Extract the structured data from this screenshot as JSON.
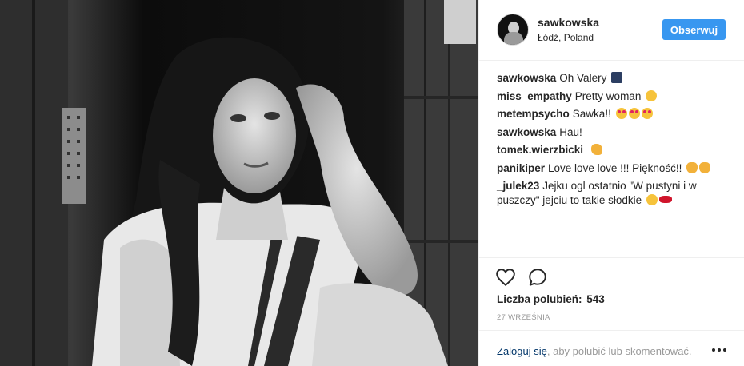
{
  "header": {
    "username": "sawkowska",
    "location": "Łódź, Poland",
    "follow_label": "Obserwuj"
  },
  "comments": [
    {
      "user": "sawkowska",
      "text": "Oh Valery",
      "emoji": [
        "camera-emoji"
      ]
    },
    {
      "user": "miss_empathy",
      "text": "Pretty woman",
      "emoji": [
        "smile-emoji"
      ]
    },
    {
      "user": "metempsycho",
      "text": "Sawka!!",
      "emoji": [
        "heart-eyes-emoji",
        "heart-eyes-emoji",
        "heart-eyes-emoji"
      ]
    },
    {
      "user": "sawkowska",
      "text": "Hau!",
      "emoji": []
    },
    {
      "user": "tomek.wierzbicki",
      "text": "",
      "emoji": [
        "muscle-emoji"
      ]
    },
    {
      "user": "panikiper",
      "text": "Love love love !!! Piękność!!",
      "emoji": [
        "ok-hand-emoji",
        "ok-hand-emoji"
      ]
    },
    {
      "user": "_julek23",
      "text": "Jejku ogl ostatnio \"W pustyni i w puszczy\" jejciu to takie słodkie",
      "emoji": [
        "crying-emoji",
        "lips-emoji"
      ]
    }
  ],
  "likes": {
    "label": "Liczba polubień:",
    "count": "543"
  },
  "date": "27 września",
  "footer": {
    "login_label": "Zaloguj się",
    "rest_text": ", aby polubić lub skomentować."
  },
  "icons": {
    "like": "heart-outline-icon",
    "comment": "speech-bubble-icon",
    "more": "more-options-icon"
  },
  "colors": {
    "follow_button": "#3897f0",
    "link": "#003569",
    "muted": "#999999"
  }
}
